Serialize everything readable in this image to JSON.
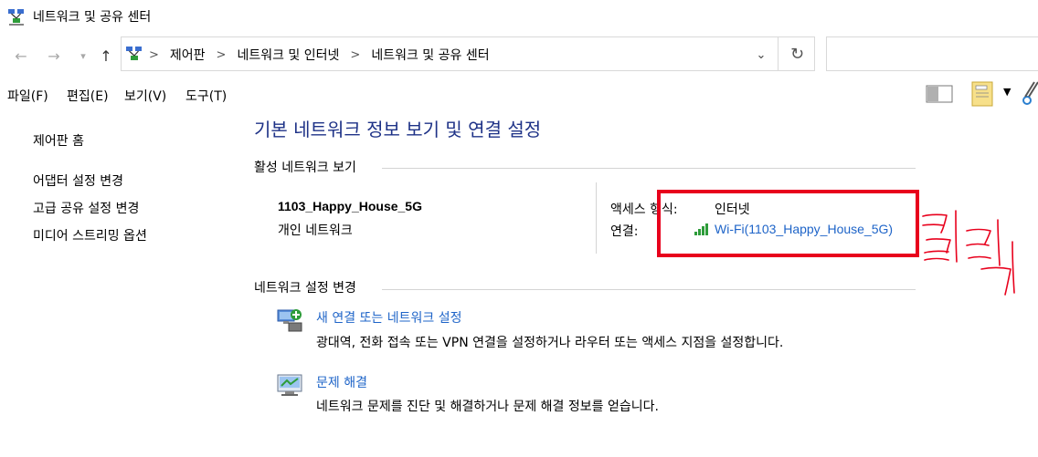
{
  "window": {
    "title": "네트워크 및 공유 센터"
  },
  "navigation": {
    "breadcrumbs": [
      "제어판",
      "네트워크 및 인터넷",
      "네트워크 및 공유 센터"
    ]
  },
  "menu": [
    "파일(F)",
    "편집(E)",
    "보기(V)",
    "도구(T)"
  ],
  "sidebar": {
    "home": "제어판 홈",
    "links": [
      "어댑터 설정 변경",
      "고급 공유 설정 변경",
      "미디어 스트리밍 옵션"
    ]
  },
  "main": {
    "title": "기본 네트워크 정보 보기 및 연결 설정",
    "active_section": "활성 네트워크 보기",
    "network": {
      "name": "1103_Happy_House_5G",
      "type": "개인 네트워크",
      "access_label": "액세스 형식:",
      "access_value": "인터넷",
      "connection_label": "연결:",
      "connection_value": "Wi-Fi(1103_Happy_House_5G)"
    },
    "change_section": "네트워크 설정 변경",
    "tasks": [
      {
        "link": "새 연결 또는 네트워크 설정",
        "desc": "광대역, 전화 접속 또는 VPN 연결을 설정하거나 라우터 또는 액세스 지점을 설정합니다."
      },
      {
        "link": "문제 해결",
        "desc": "네트워크 문제를 진단 및 해결하거나 문제 해결 정보를 얻습니다."
      }
    ]
  },
  "annotation": {
    "handwritten_text": "클릭",
    "color": "#e8001c"
  },
  "colors": {
    "title_blue": "#1e3287",
    "link_blue": "#1e64c8"
  }
}
